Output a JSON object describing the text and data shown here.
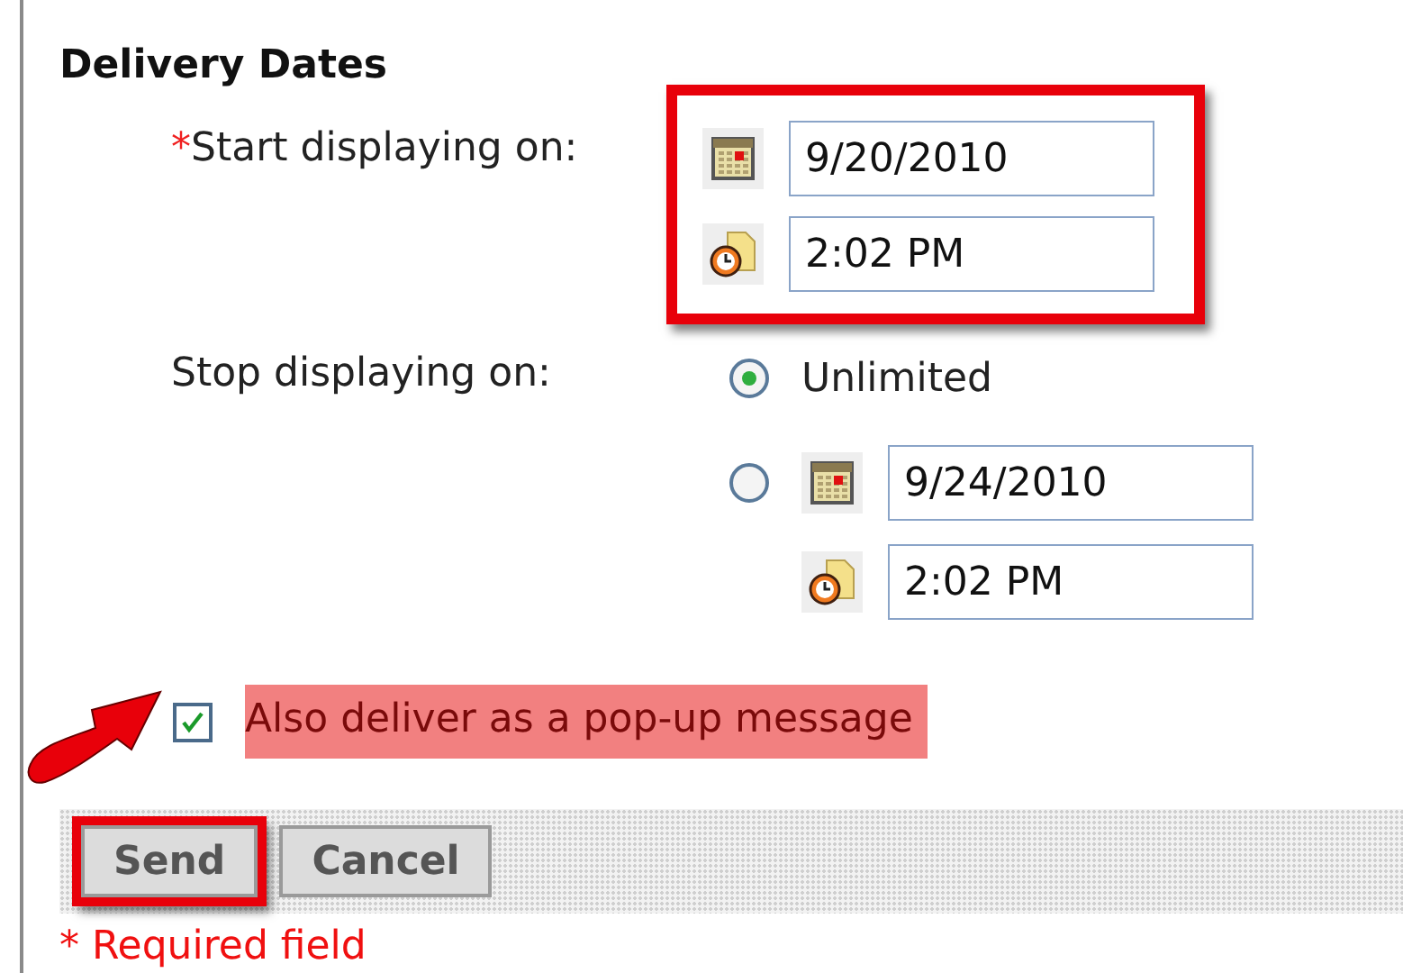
{
  "section": {
    "title": "Delivery Dates"
  },
  "start": {
    "required_mark": "*",
    "label": "Start displaying on:",
    "date": "9/20/2010",
    "time": "2:02 PM",
    "highlighted": true
  },
  "stop": {
    "label": "Stop displaying on:",
    "options": [
      {
        "kind": "unlimited",
        "label": "Unlimited",
        "selected": true
      },
      {
        "kind": "date",
        "date": "9/24/2010",
        "time": "2:02 PM",
        "selected": false
      }
    ]
  },
  "popup_option": {
    "label": "Also deliver as a pop-up message",
    "checked": true,
    "highlighted": true
  },
  "buttons": [
    {
      "label": "Send",
      "highlighted": true
    },
    {
      "label": "Cancel",
      "highlighted": false
    }
  ],
  "footnote": "* Required field"
}
